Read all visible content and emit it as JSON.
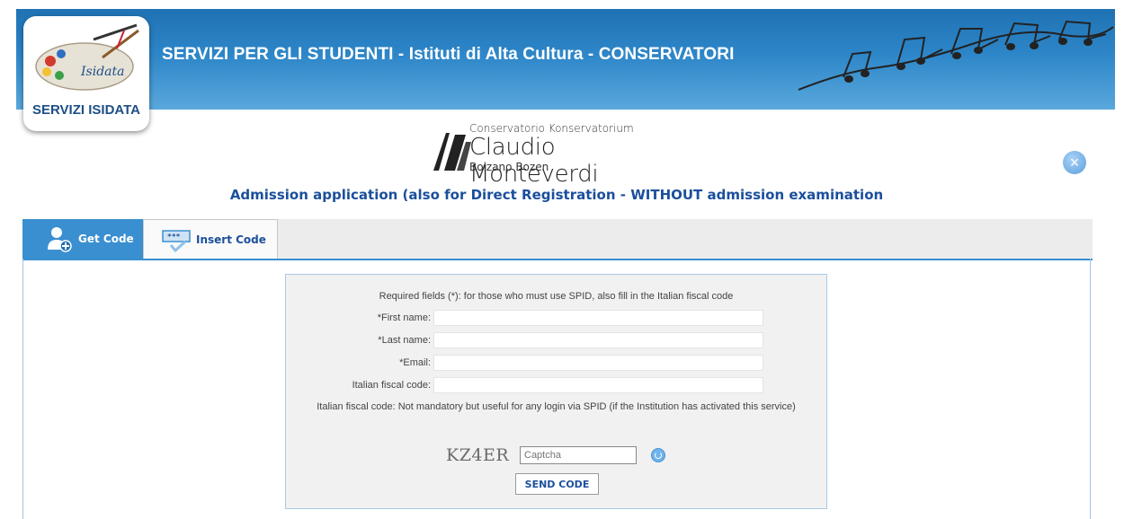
{
  "header": {
    "title": "SERVIZI PER GLI STUDENTI - Istituti di Alta Cultura - CONSERVATORI",
    "logo_brand": "Isidata",
    "logo_caption": "SERVIZI ISIDATA"
  },
  "institution": {
    "line1": "Conservatorio Konservatorium",
    "line2": "Claudio Monteverdi",
    "line3": "Bolzano Bozen"
  },
  "page_heading": "Admission application (also for Direct Registration - WITHOUT admission examination",
  "close_icon": "close-icon",
  "tabs": [
    {
      "label": "Get Code",
      "icon": "user-add-icon",
      "active": true
    },
    {
      "label": "Insert Code",
      "icon": "code-entry-icon",
      "active": false
    }
  ],
  "form": {
    "required_note": "Required fields (*): for those who must use SPID, also fill in the Italian fiscal code",
    "fields": [
      {
        "label": "*First name:",
        "value": ""
      },
      {
        "label": "*Last name:",
        "value": ""
      },
      {
        "label": "*Email:",
        "value": ""
      },
      {
        "label": "Italian fiscal code:",
        "value": ""
      }
    ],
    "fiscal_note": "Italian fiscal code: Not mandatory but useful for any login via SPID (if the Institution has activated this service)",
    "captcha_text": "KZ4ER",
    "captcha_placeholder": "Captcha",
    "send_label": "SEND CODE"
  },
  "colors": {
    "header_blue": "#2d86c8",
    "heading_blue": "#1b4f9c",
    "tab_active": "#3a8fd0"
  }
}
